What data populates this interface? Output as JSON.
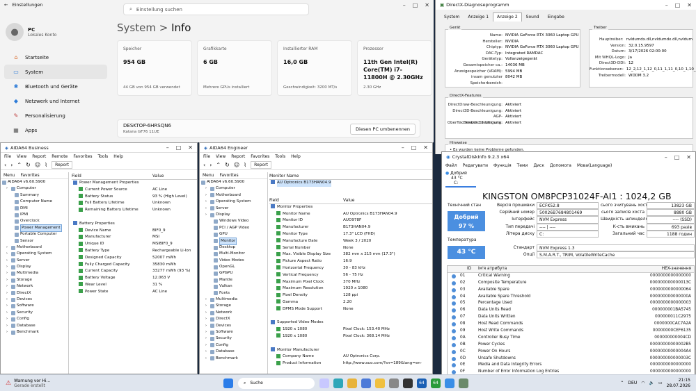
{
  "settings": {
    "title": "Einstellungen",
    "search_placeholder": "Einstellung suchen",
    "user_name": "PC",
    "user_sub": "Lokales Konto",
    "nav": [
      {
        "label": "Startseite",
        "icon": "home-icon",
        "glyph": "⌂",
        "color": "#d86b2c"
      },
      {
        "label": "System",
        "icon": "monitor-icon",
        "glyph": "▭",
        "color": "#2c7bd8"
      },
      {
        "label": "Bluetooth und Geräte",
        "icon": "bluetooth-icon",
        "glyph": "✱",
        "color": "#2c7bd8"
      },
      {
        "label": "Netzwerk und Internet",
        "icon": "wifi-icon",
        "glyph": "◆",
        "color": "#2c7bd8"
      },
      {
        "label": "Personalisierung",
        "icon": "brush-icon",
        "glyph": "✎",
        "color": "#c04040"
      },
      {
        "label": "Apps",
        "icon": "apps-icon",
        "glyph": "▦",
        "color": "#555"
      }
    ],
    "crumb_parent": "System",
    "crumb_sep": ">",
    "crumb_current": "Info",
    "cards": [
      {
        "title": "Speicher",
        "value": "954 GB",
        "sub": "44 GB von 954 GB verwendet"
      },
      {
        "title": "Grafikkarte",
        "value": "6 GB",
        "sub": "Mehrere GPUs installiert"
      },
      {
        "title": "Installierter RAM",
        "value": "16,0 GB",
        "sub": "Geschwindigkeit: 3200 MT/s"
      },
      {
        "title": "Prozessor",
        "value": "11th Gen Intel(R) Core(TM) i7-11800H @ 2.30GHz",
        "sub": "2.30 GHz"
      }
    ],
    "pc_name": "DESKTOP-6HRSQN6",
    "pc_model": "Katana GF76 11UE",
    "rename_button": "Diesen PC umbenennen"
  },
  "dx": {
    "title": "DirectX-Diagnoseprogramm",
    "tabs": [
      "System",
      "Anzeige 1",
      "Anzeige 2",
      "Sound",
      "Eingabe"
    ],
    "active_tab": "Anzeige 2",
    "device_label": "Gerät",
    "driver_label": "Treiber",
    "device": [
      [
        "Name:",
        "NVIDIA GeForce RTX 3060 Laptop GPU"
      ],
      [
        "Hersteller:",
        "NVIDIA"
      ],
      [
        "Chiptyp:",
        "NVIDIA GeForce RTX 3060 Laptop GPU"
      ],
      [
        "DAC-Typ:",
        "Integrated RAMDAC"
      ],
      [
        "Gerätetyp:",
        "Vollanzeigegerät"
      ],
      [
        "Gesamtspeicher ca.:",
        "14036 MB"
      ],
      [
        "Anzeigespeicher (VRAM):",
        "5994 MB"
      ],
      [
        "insam genutzter Speicherbereich:",
        "8042 MB"
      ]
    ],
    "driver": [
      [
        "Hauptreiber:",
        "nvldumdx.dll,nvldumdx.dll,nvldum"
      ],
      [
        "Version:",
        "32.0.15.9597"
      ],
      [
        "Datum:",
        "3/17/2026 02:00:00"
      ],
      [
        "Mit WHQL-Logo:",
        "Ja"
      ],
      [
        "Direct3D-DDI:",
        "12"
      ],
      [
        "Funktionsebenen:",
        "12_2,12_1,12_0,11_1,11_0,10_1,10_"
      ],
      [
        "Treibermodell:",
        "WDDM 3.2"
      ]
    ],
    "features_label": "DirectX-Features",
    "features": [
      [
        "DirectDraw-Beschleunigung:",
        "Aktiviert"
      ],
      [
        "Direct3D-Beschleunigung:",
        "Aktiviert"
      ],
      [
        "AGP-Oberflächenbeschleunigung:",
        "Aktiviert"
      ],
      [
        "DirectX 12 Ultimate:",
        "Aktiviert"
      ]
    ],
    "notes_label": "Hinweise",
    "note": "Es wurden keine Probleme gefunden."
  },
  "aida1": {
    "title": "AIDA64 Business",
    "menu": [
      "File",
      "View",
      "Report",
      "Remote",
      "Favorites",
      "Tools",
      "Help"
    ],
    "report": "Report",
    "tab_menu": "Menu",
    "tab_fav": "Favorites",
    "tree": [
      "AIDA64 v6.60.5900",
      "Computer",
      "Summary",
      "Computer Name",
      "DMI",
      "IPMI",
      "Overclock",
      "Power Management",
      "Portable Computer",
      "Sensor",
      "Motherboard",
      "Operating System",
      "Server",
      "Display",
      "Multimedia",
      "Storage",
      "Network",
      "DirectX",
      "Devices",
      "Software",
      "Security",
      "Config",
      "Database",
      "Benchmark"
    ],
    "col_field": "Field",
    "col_value": "Value",
    "rows": [
      [
        "Power Management Properties",
        "",
        1
      ],
      [
        "Current Power Source",
        "AC Line",
        0
      ],
      [
        "Battery Status",
        "93 % (High Level)",
        0
      ],
      [
        "Full Battery Lifetime",
        "Unknown",
        0
      ],
      [
        "Remaining Battery Lifetime",
        "Unknown",
        0
      ],
      [
        "",
        "",
        2
      ],
      [
        "Battery Properties",
        "",
        1
      ],
      [
        "Device Name",
        "BIF0_9",
        0
      ],
      [
        "Manufacturer",
        "MSI",
        0
      ],
      [
        "Unique ID",
        "MSIBIF0_9",
        0
      ],
      [
        "Battery Type",
        "Rechargeable Li-Ion",
        0
      ],
      [
        "Designed Capacity",
        "52007 mWh",
        0
      ],
      [
        "Fully Charged Capacity",
        "35830 mWh",
        0
      ],
      [
        "Current Capacity",
        "33277 mWh  (93 %)",
        0
      ],
      [
        "Battery Voltage",
        "12.063 V",
        0
      ],
      [
        "Wear Level",
        "31 %",
        0
      ],
      [
        "Power State",
        "AC Line",
        0
      ]
    ]
  },
  "aida2": {
    "title": "AIDA64 Engineer",
    "menu": [
      "File",
      "View",
      "Report",
      "Favorites",
      "Tools",
      "Help"
    ],
    "report": "Report",
    "tab_menu": "Menu",
    "tab_fav": "Favorites",
    "tree": [
      "AIDA64 v6.60.5900",
      "Computer",
      "Motherboard",
      "Operating System",
      "Server",
      "Display",
      "Windows Video",
      "PCI / AGP Video",
      "GPU",
      "Monitor",
      "Desktop",
      "Multi-Monitor",
      "Video Modes",
      "OpenGL",
      "GPGPU",
      "Mantle",
      "Vulkan",
      "Fonts",
      "Multimedia",
      "Storage",
      "Network",
      "DirectX",
      "Devices",
      "Software",
      "Security",
      "Config",
      "Database",
      "Benchmark"
    ],
    "monitor_name_header": "Monitor Name",
    "monitor_name": "AU Optronics B173HAN04.9",
    "col_field": "Field",
    "col_value": "Value",
    "rows": [
      [
        "Monitor Properties",
        "",
        1
      ],
      [
        "Monitor Name",
        "AU Optronics B173HAN04.9",
        0
      ],
      [
        "Monitor ID",
        "AUO978F",
        0
      ],
      [
        "Manufacturer",
        "B173HAN04.9",
        0
      ],
      [
        "Monitor Type",
        "17.3\" LCD (FHD)",
        0
      ],
      [
        "Manufacture Date",
        "Week 3 / 2020",
        0
      ],
      [
        "Serial Number",
        "None",
        0
      ],
      [
        "Max. Visible Display Size",
        "382 mm x 215 mm (17.3\")",
        0
      ],
      [
        "Picture Aspect Ratio",
        "16:9",
        0
      ],
      [
        "Horizontal Frequency",
        "30 - 83 kHz",
        0
      ],
      [
        "Vertical Frequency",
        "56 - 75 Hz",
        0
      ],
      [
        "Maximum Pixel Clock",
        "370 MHz",
        0
      ],
      [
        "Maximum Resolution",
        "1920 x 1080",
        0
      ],
      [
        "Pixel Density",
        "128 ppi",
        0
      ],
      [
        "Gamma",
        "2.20",
        0
      ],
      [
        "DPMS Mode Support",
        "None",
        0
      ],
      [
        "",
        "",
        2
      ],
      [
        "Supported Video Modes",
        "",
        1
      ],
      [
        "1920 x 1080",
        "Pixel Clock: 153.40 MHz",
        0
      ],
      [
        "1920 x 1080",
        "Pixel Clock: 368.14 MHz",
        0
      ],
      [
        "",
        "",
        2
      ],
      [
        "Monitor Manufacturer",
        "",
        1
      ],
      [
        "Company Name",
        "AU Optronics Corp.",
        0
      ],
      [
        "Product Information",
        "http://www.auo.com/?sn=189&lang=en-",
        0
      ]
    ]
  },
  "cdi": {
    "title": "CrystalDiskInfo 9.2.3 x64",
    "menu": [
      "Файл",
      "Редагувати",
      "Функція",
      "Теми",
      "Диск",
      "Допомога",
      "Мова(Language)"
    ],
    "drive_status": "Добрий",
    "drive_temp_small": "43 °C",
    "drive_letter": "C:",
    "drive_title": "KINGSTON OM8PCP31024F-AI1 : 1024,2 GB",
    "health_label": "Технічний стан",
    "health_status": "Добрий",
    "health_pct": "97 %",
    "temp_label": "Температура",
    "temp": "43 °C",
    "left": [
      [
        "Версія прошивки",
        "ECFK52.8"
      ],
      [
        "Серійний номер",
        "50026B7684801469"
      ],
      [
        "Інтерфейс",
        "NVM Express"
      ],
      [
        "Тип передачі",
        "---- | ----"
      ],
      [
        "Літера диску",
        "C:"
      ]
    ],
    "right": [
      [
        "сього зчитувань хоста",
        "13823 GB"
      ],
      [
        "сього записів хоста",
        "8880 GB"
      ],
      [
        "Швидкість шпинделя",
        "---- (SSD)"
      ],
      [
        "К-сть вмикань",
        "693 разів"
      ],
      [
        "Загальний час",
        "1188 годин"
      ]
    ],
    "standard_label": "Стандарт",
    "standard": "NVM Express 1.3",
    "features_label": "Опції",
    "features": "S.M.A.R.T., TRIM, VolatileWriteCache",
    "smart_cols": [
      "ID",
      "Ім'я атрибута",
      "HEX-значення"
    ],
    "smart": [
      [
        "01",
        "Critical Warning",
        "0000000000000000"
      ],
      [
        "02",
        "Composite Temperature",
        "000000000000013C"
      ],
      [
        "03",
        "Available Spare",
        "0000000000000064"
      ],
      [
        "04",
        "Available Spare Threshold",
        "000000000000000A"
      ],
      [
        "05",
        "Percentage Used",
        "0000000000000003"
      ],
      [
        "06",
        "Data Units Read",
        "000000001BA5745"
      ],
      [
        "07",
        "Data Units Written",
        "000000011C2975"
      ],
      [
        "08",
        "Host Read Commands",
        "0000000CAC7A2A"
      ],
      [
        "09",
        "Host Write Commands",
        "00000000CEF6135"
      ],
      [
        "0A",
        "Controller Busy Time",
        "000000000004CD"
      ],
      [
        "0B",
        "Power Cycles",
        "00000000000002B5"
      ],
      [
        "0C",
        "Power On Hours",
        "00000000000004A4"
      ],
      [
        "0D",
        "Unsafe Shutdowns",
        "000000000000003C"
      ],
      [
        "0E",
        "Media and Data Integrity Errors",
        "0000000000000000"
      ],
      [
        "0F",
        "Number of Error Information Log Entries",
        "0000000000000000"
      ]
    ]
  },
  "taskbar": {
    "notif_title": "Warnung vor Hi...",
    "notif_sub": "Gerade erstellt",
    "search": "Suche",
    "lang": "DEU",
    "time": "21:15",
    "date": "28.07.2026",
    "tray_64": "64"
  }
}
